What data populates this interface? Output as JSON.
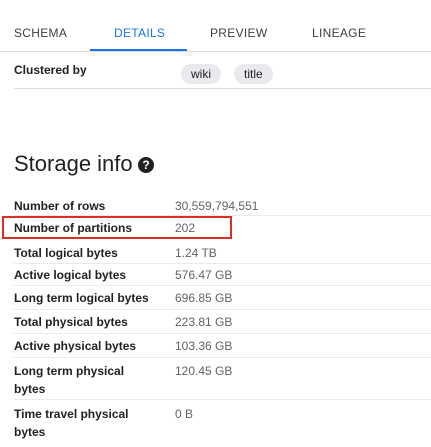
{
  "tabs": [
    {
      "label": "SCHEMA"
    },
    {
      "label": "DETAILS"
    },
    {
      "label": "PREVIEW"
    },
    {
      "label": "LINEAGE"
    }
  ],
  "clustered_by": {
    "label": "Clustered by",
    "chips": [
      "wiki",
      "title"
    ]
  },
  "storage": {
    "heading": "Storage info",
    "rows": [
      {
        "label": "Number of rows",
        "value": "30,559,794,551"
      },
      {
        "label": "Number of partitions",
        "value": "202"
      },
      {
        "label": "Total logical bytes",
        "value": "1.24 TB"
      },
      {
        "label": "Active logical bytes",
        "value": "576.47 GB"
      },
      {
        "label": "Long term logical bytes",
        "value": "696.85 GB"
      },
      {
        "label": "Total physical bytes",
        "value": "223.81 GB"
      },
      {
        "label": "Active physical bytes",
        "value": "103.36 GB"
      },
      {
        "label": "Long term physical bytes",
        "value": "120.45 GB"
      },
      {
        "label": "Time travel physical bytes",
        "value": "0 B"
      }
    ]
  },
  "colors": {
    "accent": "#1a73e8",
    "highlight": "#d93025"
  },
  "icons": {
    "help": "help-circle-icon"
  }
}
